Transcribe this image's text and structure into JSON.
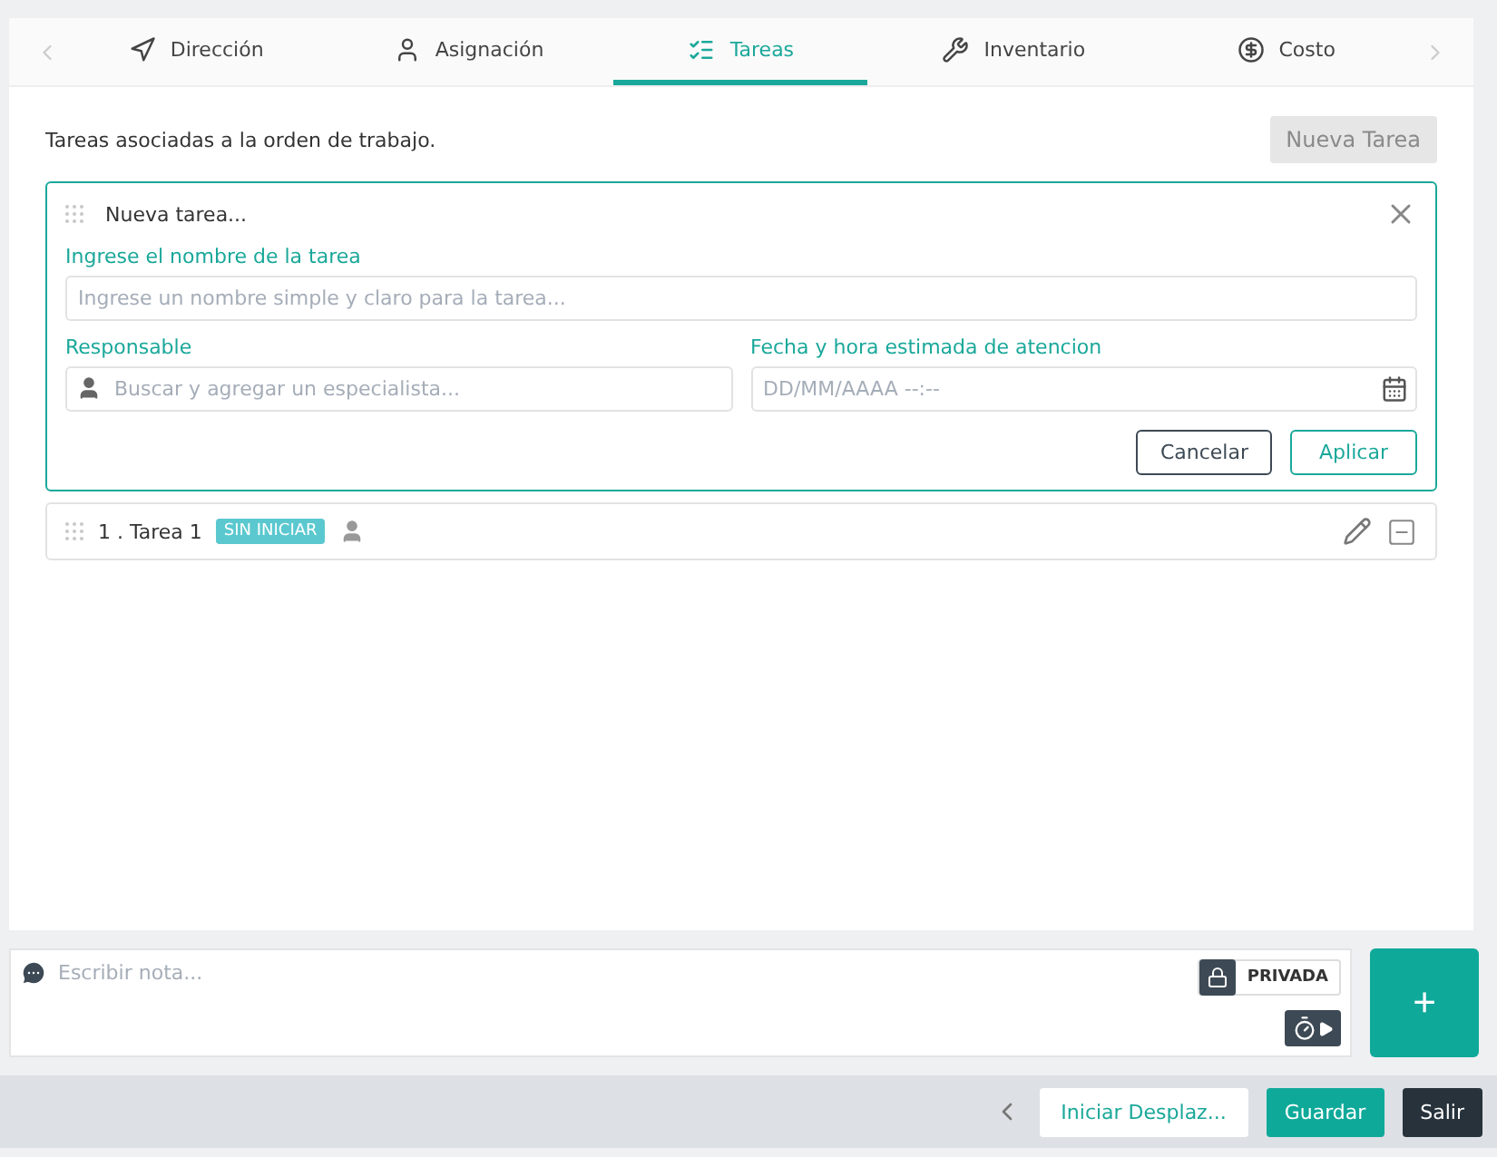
{
  "tabs": [
    {
      "label": "Dirección",
      "selected": false
    },
    {
      "label": "Asignación",
      "selected": false
    },
    {
      "label": "Tareas",
      "selected": true
    },
    {
      "label": "Inventario",
      "selected": false
    },
    {
      "label": "Costo",
      "selected": false
    }
  ],
  "intro": "Tareas asociadas a la orden de trabajo.",
  "new_task_button": {
    "label": "Nueva Tarea",
    "disabled": true
  },
  "new_task_form": {
    "title": "Nueva tarea...",
    "name_label": "Ingrese el nombre de la tarea",
    "name_placeholder": "Ingrese un nombre simple y claro para la tarea...",
    "responsible_label": "Responsable",
    "responsible_placeholder": "Buscar y agregar un especialista...",
    "date_label": "Fecha y hora estimada de atencion",
    "date_placeholder": "DD/MM/AAAA --:--",
    "buttons": [
      "Cancelar",
      "Aplicar"
    ]
  },
  "tasks": [
    {
      "title": "1 . Tarea 1",
      "status": "SIN INICIAR"
    }
  ],
  "note": {
    "placeholder": "Escribir nota...",
    "privacy": "PRIVADA"
  },
  "add_button": "+",
  "footer": {
    "buttons": [
      "Iniciar Desplaz...",
      "Guardar",
      "Salir"
    ]
  }
}
